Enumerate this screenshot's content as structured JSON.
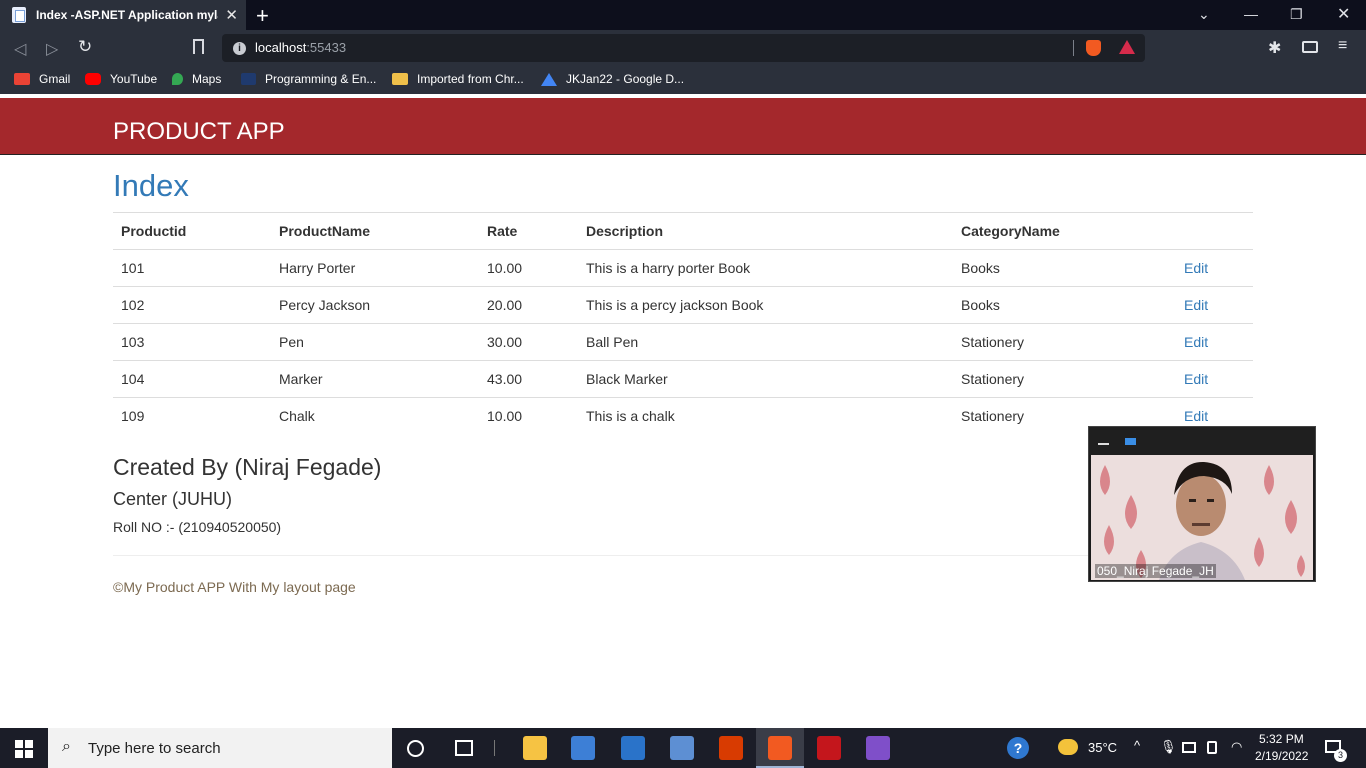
{
  "browser": {
    "tab_title": "Index -ASP.NET Application mylayout",
    "url_host": "localhost",
    "url_port": ":55433",
    "bookmarks": [
      "Gmail",
      "YouTube",
      "Maps",
      "Programming & En...",
      "Imported from Chr...",
      "JKJan22 - Google D..."
    ]
  },
  "app": {
    "brand": "PRODUCT APP",
    "heading": "Index",
    "table": {
      "headers": [
        "Productid",
        "ProductName",
        "Rate",
        "Description",
        "CategoryName",
        ""
      ],
      "rows": [
        [
          "101",
          "Harry Porter",
          "10.00",
          "This is a harry porter Book",
          "Books",
          "Edit"
        ],
        [
          "102",
          "Percy Jackson",
          "20.00",
          "This is a percy jackson Book",
          "Books",
          "Edit"
        ],
        [
          "103",
          "Pen",
          "30.00",
          "Ball Pen",
          "Stationery",
          "Edit"
        ],
        [
          "104",
          "Marker",
          "43.00",
          "Black Marker",
          "Stationery",
          "Edit"
        ],
        [
          "109",
          "Chalk",
          "10.00",
          "This is a chalk",
          "Stationery",
          "Edit"
        ]
      ]
    },
    "created_by": "Created By (Niraj Fegade)",
    "center": "Center (JUHU)",
    "roll": "Roll NO :- (210940520050)",
    "footer": "©My Product APP With My layout page"
  },
  "video": {
    "name": "050_Niraj Fegade_JH"
  },
  "taskbar": {
    "search_placeholder": "Type here to search",
    "temperature": "35°C",
    "time": "5:32 PM",
    "date": "2/19/2022",
    "notifications": "3"
  },
  "colors": {
    "navbar": "#a4282c",
    "link": "#337ab7",
    "footer_text": "#7c6a51"
  }
}
